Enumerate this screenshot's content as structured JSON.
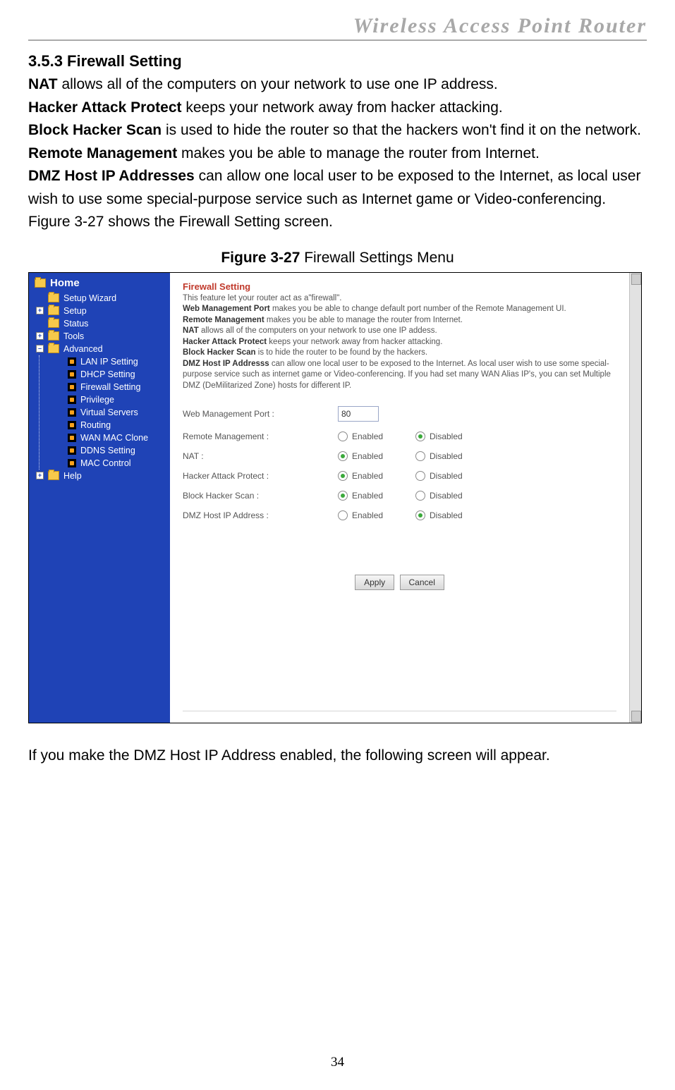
{
  "header": "Wireless  Access  Point  Router",
  "section_heading": "3.5.3 Firewall Setting",
  "intro": {
    "nat_b": "NAT",
    "nat_t": " allows all of the computers on your network to use one IP address.",
    "hap_b": "Hacker Attack Protect",
    "hap_t": " keeps your network away from hacker attacking.",
    "bhs_b": "Block Hacker Scan",
    "bhs_t": " is used to hide the router so that the hackers won't find it on the network.",
    "rm_b": "Remote Management",
    "rm_t": " makes you be able to manage the router from Internet.",
    "dmz_b": "DMZ Host IP Addresses",
    "dmz_t": " can allow one local user to be exposed to the Internet, as local user wish to use some special-purpose service such as Internet game or Video-conferencing. Figure 3-27 shows the Firewall Setting screen."
  },
  "fig_label_b": "Figure 3-27",
  "fig_label_t": " Firewall Settings Menu",
  "sidebar": {
    "home": "Home",
    "groups": [
      "Setup Wizard",
      "Setup",
      "Status",
      "Tools",
      "Advanced",
      "Help"
    ],
    "advanced_items": [
      "LAN IP Setting",
      "DHCP Setting",
      "Firewall Setting",
      "Privilege",
      "Virtual Servers",
      "Routing",
      "WAN MAC Clone",
      "DDNS Setting",
      "MAC Control"
    ]
  },
  "panel": {
    "title": "Firewall Setting",
    "desc_intro": "This feature let your router act as a\"firewall\".",
    "wmp_b": "Web Management Port",
    "wmp_t": " makes you be able to change default port number of the Remote Management UI.",
    "rm_b": "Remote Management",
    "rm_t": " makes you be able to manage the router from Internet.",
    "nat_b": "NAT",
    "nat_t": " allows all of the computers on your network to use one IP addess.",
    "hap_b": "Hacker Attack Protect",
    "hap_t": " keeps your network away from hacker attacking.",
    "bhs_b": "Block Hacker Scan",
    "bhs_t": " is to hide the router to be found by the hackers.",
    "dmz_b": "DMZ Host IP Addresss",
    "dmz_t": " can allow one local user to be exposed to the Internet. As local user wish to use some special-purpose service such as internet game or Video-conferencing.  If you had set many WAN Alias IP's, you can set Multiple DMZ (DeMilitarized Zone) hosts for different IP."
  },
  "form": {
    "wmp_label": "Web Management Port :",
    "wmp_value": "80",
    "rows": [
      {
        "label": "Remote Management :",
        "enabled": false
      },
      {
        "label": "NAT :",
        "enabled": true
      },
      {
        "label": "Hacker Attack Protect :",
        "enabled": true
      },
      {
        "label": "Block Hacker Scan :",
        "enabled": true
      },
      {
        "label": "DMZ Host IP Address :",
        "enabled": false
      }
    ],
    "opt_enabled": "Enabled",
    "opt_disabled": "Disabled",
    "apply": "Apply",
    "cancel": "Cancel"
  },
  "after_text": "If you make the DMZ Host IP Address enabled, the following screen will appear.",
  "page_num": "34"
}
